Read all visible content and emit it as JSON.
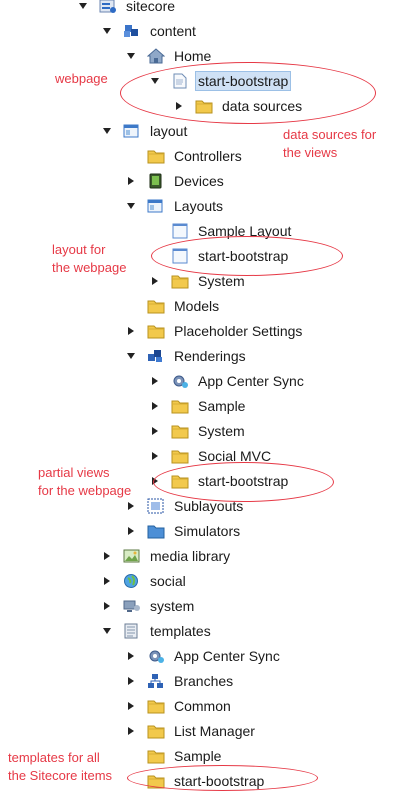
{
  "colors": {
    "annotation": "#e63946",
    "selection": "#cfe1f5",
    "folder": "#f2c94c"
  },
  "tree": [
    {
      "label": "sitecore",
      "expand": "expanded",
      "icon": "sitecore-icon",
      "depth": 0
    },
    {
      "label": "content",
      "expand": "expanded",
      "icon": "content-icon",
      "depth": 1
    },
    {
      "label": "Home",
      "expand": "expanded",
      "icon": "home-icon",
      "depth": 2
    },
    {
      "label": "start-bootstrap",
      "expand": "expanded",
      "icon": "page-icon",
      "depth": 3,
      "selected": true
    },
    {
      "label": "data sources",
      "expand": "collapsed",
      "icon": "folder-icon",
      "depth": 4
    },
    {
      "label": "layout",
      "expand": "expanded",
      "icon": "layout-icon",
      "depth": 1
    },
    {
      "label": "Controllers",
      "expand": "none",
      "icon": "folder-icon",
      "depth": 2
    },
    {
      "label": "Devices",
      "expand": "collapsed",
      "icon": "device-icon",
      "depth": 2
    },
    {
      "label": "Layouts",
      "expand": "expanded",
      "icon": "layout-icon",
      "depth": 2
    },
    {
      "label": "Sample Layout",
      "expand": "none",
      "icon": "layout-file-icon",
      "depth": 3
    },
    {
      "label": "start-bootstrap",
      "expand": "none",
      "icon": "layout-file-icon",
      "depth": 3
    },
    {
      "label": "System",
      "expand": "collapsed",
      "icon": "folder-icon",
      "depth": 3
    },
    {
      "label": "Models",
      "expand": "none",
      "icon": "folder-icon",
      "depth": 2
    },
    {
      "label": "Placeholder Settings",
      "expand": "collapsed",
      "icon": "folder-icon",
      "depth": 2
    },
    {
      "label": "Renderings",
      "expand": "expanded",
      "icon": "renderings-icon",
      "depth": 2
    },
    {
      "label": "App Center Sync",
      "expand": "collapsed",
      "icon": "gear-icon",
      "depth": 3
    },
    {
      "label": "Sample",
      "expand": "collapsed",
      "icon": "folder-icon",
      "depth": 3
    },
    {
      "label": "System",
      "expand": "collapsed",
      "icon": "folder-icon",
      "depth": 3
    },
    {
      "label": "Social MVC",
      "expand": "collapsed",
      "icon": "folder-icon",
      "depth": 3
    },
    {
      "label": "start-bootstrap",
      "expand": "collapsed",
      "icon": "folder-icon",
      "depth": 3
    },
    {
      "label": "Sublayouts",
      "expand": "collapsed",
      "icon": "sublayout-icon",
      "depth": 2
    },
    {
      "label": "Simulators",
      "expand": "collapsed",
      "icon": "simulator-folder-icon",
      "depth": 2
    },
    {
      "label": "media library",
      "expand": "collapsed",
      "icon": "media-icon",
      "depth": 1
    },
    {
      "label": "social",
      "expand": "collapsed",
      "icon": "globe-icon",
      "depth": 1
    },
    {
      "label": "system",
      "expand": "collapsed",
      "icon": "system-icon",
      "depth": 1
    },
    {
      "label": "templates",
      "expand": "expanded",
      "icon": "templates-icon",
      "depth": 1
    },
    {
      "label": "App Center Sync",
      "expand": "collapsed",
      "icon": "gear-icon",
      "depth": 2
    },
    {
      "label": "Branches",
      "expand": "collapsed",
      "icon": "branches-icon",
      "depth": 2
    },
    {
      "label": "Common",
      "expand": "collapsed",
      "icon": "folder-icon",
      "depth": 2
    },
    {
      "label": "List Manager",
      "expand": "collapsed",
      "icon": "folder-icon",
      "depth": 2
    },
    {
      "label": "Sample",
      "expand": "none",
      "icon": "folder-icon",
      "depth": 2
    },
    {
      "label": "start-bootstrap",
      "expand": "none",
      "icon": "folder-icon",
      "depth": 2
    }
  ],
  "annotations": {
    "webpage": "webpage",
    "data_sources": "data sources for\nthe views",
    "layout": "layout for\nthe webpage",
    "partial_views": "partial views\nfor the webpage",
    "templates": "templates for all\nthe Sitecore items"
  }
}
